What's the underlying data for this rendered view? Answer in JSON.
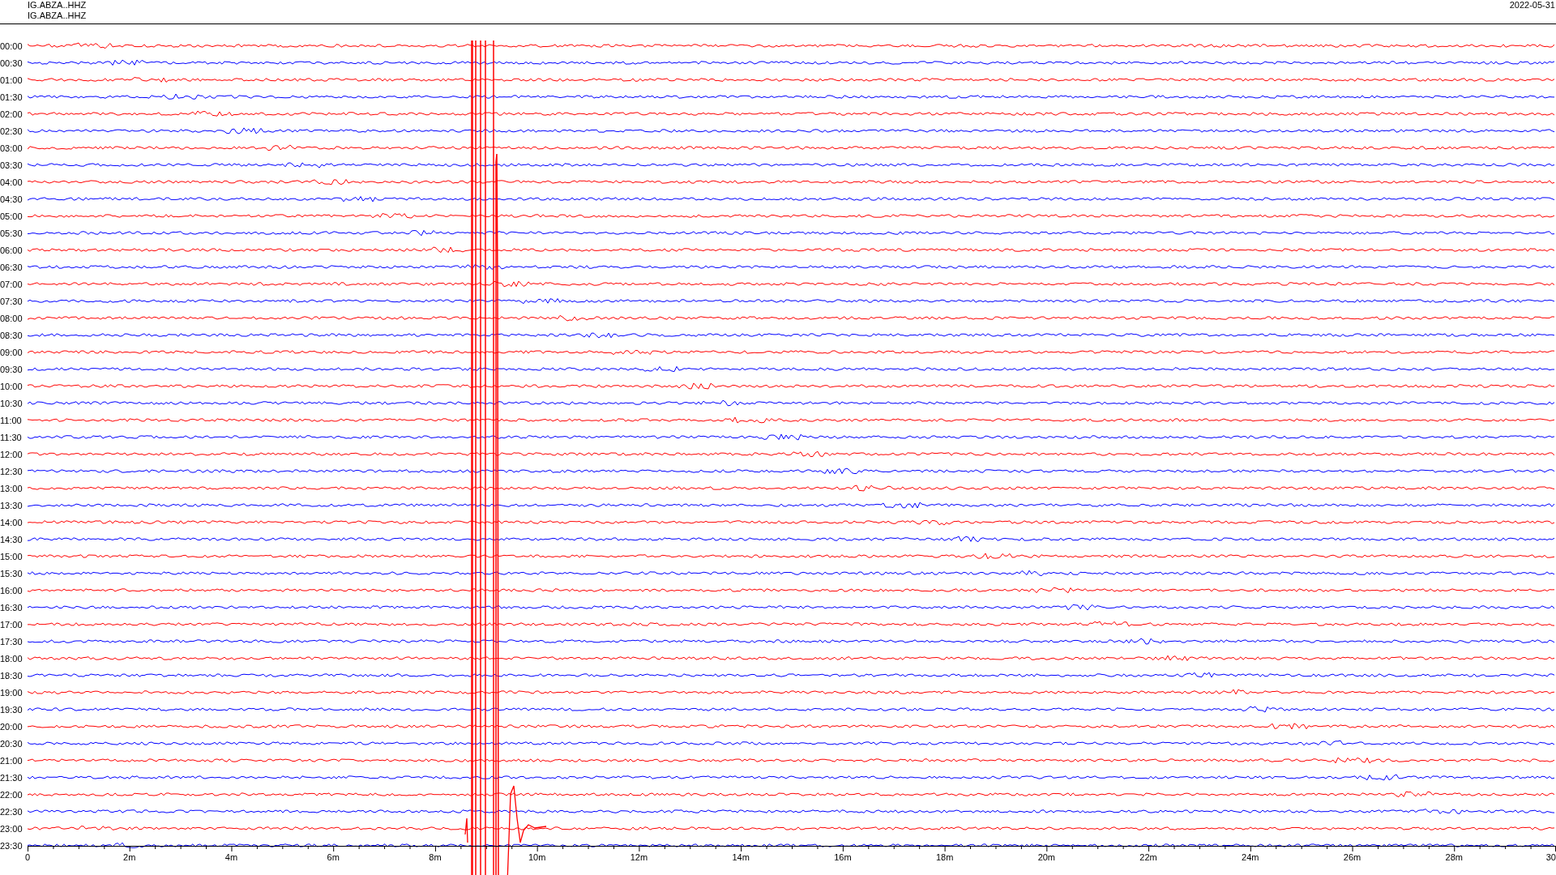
{
  "header": {
    "channels": [
      "IG.ABZA..HHZ",
      "IG.ABZA..HHZ"
    ],
    "date": "2022-05-31"
  },
  "rows": [
    {
      "label": "00:00",
      "color": "#ff0000"
    },
    {
      "label": "00:30",
      "color": "#0000ff"
    },
    {
      "label": "01:00",
      "color": "#ff0000"
    },
    {
      "label": "01:30",
      "color": "#0000ff"
    },
    {
      "label": "02:00",
      "color": "#ff0000"
    },
    {
      "label": "02:30",
      "color": "#0000ff"
    },
    {
      "label": "03:00",
      "color": "#ff0000"
    },
    {
      "label": "03:30",
      "color": "#0000ff"
    },
    {
      "label": "04:00",
      "color": "#ff0000"
    },
    {
      "label": "04:30",
      "color": "#0000ff"
    },
    {
      "label": "05:00",
      "color": "#ff0000"
    },
    {
      "label": "05:30",
      "color": "#0000ff"
    },
    {
      "label": "06:00",
      "color": "#ff0000"
    },
    {
      "label": "06:30",
      "color": "#0000ff"
    },
    {
      "label": "07:00",
      "color": "#ff0000"
    },
    {
      "label": "07:30",
      "color": "#0000ff"
    },
    {
      "label": "08:00",
      "color": "#ff0000"
    },
    {
      "label": "08:30",
      "color": "#0000ff"
    },
    {
      "label": "09:00",
      "color": "#ff0000"
    },
    {
      "label": "09:30",
      "color": "#0000ff"
    },
    {
      "label": "10:00",
      "color": "#ff0000"
    },
    {
      "label": "10:30",
      "color": "#0000ff"
    },
    {
      "label": "11:00",
      "color": "#ff0000"
    },
    {
      "label": "11:30",
      "color": "#0000ff"
    },
    {
      "label": "12:00",
      "color": "#ff0000"
    },
    {
      "label": "12:30",
      "color": "#0000ff"
    },
    {
      "label": "13:00",
      "color": "#ff0000"
    },
    {
      "label": "13:30",
      "color": "#0000ff"
    },
    {
      "label": "14:00",
      "color": "#ff0000"
    },
    {
      "label": "14:30",
      "color": "#0000ff"
    },
    {
      "label": "15:00",
      "color": "#ff0000"
    },
    {
      "label": "15:30",
      "color": "#0000ff"
    },
    {
      "label": "16:00",
      "color": "#ff0000"
    },
    {
      "label": "16:30",
      "color": "#0000ff"
    },
    {
      "label": "17:00",
      "color": "#ff0000"
    },
    {
      "label": "17:30",
      "color": "#0000ff"
    },
    {
      "label": "18:00",
      "color": "#ff0000"
    },
    {
      "label": "18:30",
      "color": "#0000ff"
    },
    {
      "label": "19:00",
      "color": "#ff0000"
    },
    {
      "label": "19:30",
      "color": "#0000ff"
    },
    {
      "label": "20:00",
      "color": "#ff0000"
    },
    {
      "label": "20:30",
      "color": "#0000ff"
    },
    {
      "label": "21:00",
      "color": "#ff0000"
    },
    {
      "label": "21:30",
      "color": "#0000ff"
    },
    {
      "label": "22:00",
      "color": "#ff0000"
    },
    {
      "label": "22:30",
      "color": "#0000ff"
    },
    {
      "label": "23:00",
      "color": "#ff0000"
    },
    {
      "label": "23:30",
      "color": "#0000ff"
    }
  ],
  "axis": {
    "ticks": [
      "0",
      "2m",
      "4m",
      "6m",
      "8m",
      "10m",
      "12m",
      "14m",
      "16m",
      "18m",
      "20m",
      "22m",
      "24m",
      "26m",
      "28m",
      "30"
    ]
  }
}
